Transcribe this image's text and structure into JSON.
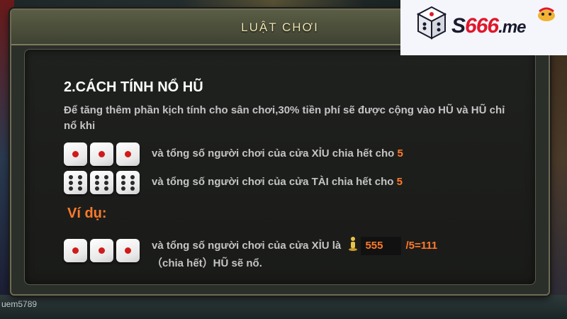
{
  "background": {
    "username": "uem5789"
  },
  "modal": {
    "title": "LUẬT CHƠI"
  },
  "section": {
    "heading": "2.CÁCH TÍNH NỔ HŨ",
    "intro": "Để tăng thêm phần kịch tính cho sân chơi,30% tiền phí sẽ được cộng vào HŨ và HŨ chỉ nổ khi"
  },
  "rules": [
    {
      "dice": [
        "one",
        "one",
        "one"
      ],
      "text": "và tổng số người chơi của cửa XỈU chia hết cho",
      "number": "5"
    },
    {
      "dice": [
        "six",
        "six",
        "six"
      ],
      "text": "và tổng số người chơi của cửa TÀI chia hết cho",
      "number": "5"
    }
  ],
  "example": {
    "label": "Ví dụ:",
    "dice": [
      "one",
      "one",
      "one"
    ],
    "text_before": "và tổng số người chơi của cửa XỈU là",
    "count": "555",
    "calc": "/5=111",
    "line2": "（chia hết）HŨ sẽ nổ."
  },
  "logo": {
    "prefix": "S",
    "number": "666",
    "domain": ".me"
  },
  "colors": {
    "accent_orange": "#ff7a2a",
    "title_gold": "#f0e3b0",
    "die_red_pip": "#d11a1a",
    "logo_red": "#e0182c"
  }
}
